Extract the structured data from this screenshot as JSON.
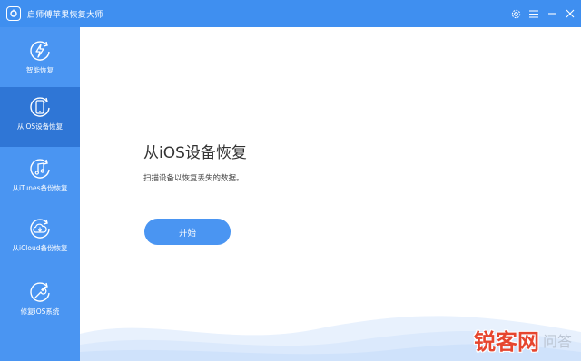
{
  "window": {
    "title": "启师傅苹果恢复大师"
  },
  "sidebar": {
    "items": [
      {
        "label": "智能恢复",
        "icon": "flash-recover-icon"
      },
      {
        "label": "从iOS设备恢复",
        "icon": "phone-recover-icon",
        "active": true
      },
      {
        "label": "从iTunes备份恢复",
        "icon": "music-recover-icon"
      },
      {
        "label": "从iCloud备份恢复",
        "icon": "cloud-recover-icon"
      },
      {
        "label": "修复iOS系统",
        "icon": "wrench-icon"
      }
    ]
  },
  "main": {
    "heading": "从iOS设备恢复",
    "description": "扫描设备以恢复丢失的数据。",
    "start_button": "开始"
  },
  "watermark": {
    "brand": "锐客网",
    "sub": "问答"
  },
  "colors": {
    "primary": "#3f8ff0",
    "sidebar": "#4a95f2",
    "sidebar_active": "#2f76d6",
    "watermark_red": "#e6452e"
  }
}
